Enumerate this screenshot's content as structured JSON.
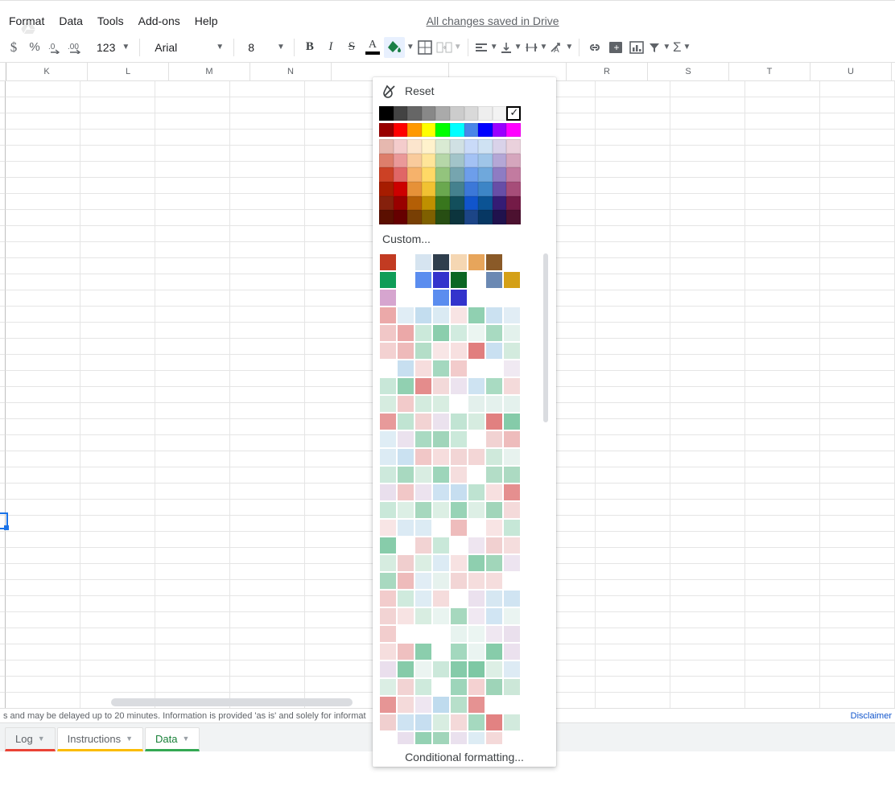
{
  "menus": [
    "Format",
    "Data",
    "Tools",
    "Add-ons",
    "Help"
  ],
  "save_status": "All changes saved in Drive",
  "toolbar": {
    "percent": "%",
    "decrement": ".0",
    "increment": ".00",
    "more_formats": "123",
    "font": "Arial",
    "fontsize": "8",
    "bold": "B",
    "italic": "I",
    "strike": "S",
    "textcolor": "A"
  },
  "columns": [
    "K",
    "L",
    "M",
    "N",
    "",
    "",
    "R",
    "S",
    "T",
    "U"
  ],
  "popover": {
    "reset_label": "Reset",
    "grayscale": [
      "#000000",
      "#434343",
      "#666666",
      "#888888",
      "#aaaaaa",
      "#cccccc",
      "#d9d9d9",
      "#eeeeee",
      "#f3f3f3",
      "#ffffff"
    ],
    "standard": [
      "#980000",
      "#ff0000",
      "#ff9900",
      "#ffff00",
      "#00ff00",
      "#00ffff",
      "#4a86e8",
      "#0000ff",
      "#9900ff",
      "#ff00ff"
    ],
    "theme": [
      [
        "#e6b8af",
        "#f4cccc",
        "#fce5cd",
        "#fff2cc",
        "#d9ead3",
        "#d0e0e3",
        "#c9daf8",
        "#cfe2f3",
        "#d9d2e9",
        "#ead1dc"
      ],
      [
        "#dd7e6b",
        "#ea9999",
        "#f9cb9c",
        "#ffe599",
        "#b6d7a8",
        "#a2c4c9",
        "#a4c2f4",
        "#9fc5e8",
        "#b4a7d6",
        "#d5a6bd"
      ],
      [
        "#cc4125",
        "#e06666",
        "#f6b26b",
        "#ffd966",
        "#93c47d",
        "#76a5af",
        "#6d9eeb",
        "#6fa8dc",
        "#8e7cc3",
        "#c27ba0"
      ],
      [
        "#a61c00",
        "#cc0000",
        "#e69138",
        "#f1c232",
        "#6aa84f",
        "#45818e",
        "#3c78d8",
        "#3d85c6",
        "#674ea7",
        "#a64d79"
      ],
      [
        "#85200c",
        "#990000",
        "#b45f06",
        "#bf9000",
        "#38761d",
        "#134f5c",
        "#1155cc",
        "#0b5394",
        "#351c75",
        "#741b47"
      ],
      [
        "#5b0f00",
        "#660000",
        "#783f04",
        "#7f6000",
        "#274e13",
        "#0c343d",
        "#1c4587",
        "#073763",
        "#20124d",
        "#4c1130"
      ]
    ],
    "custom_label": "Custom...",
    "custom_rows": [
      [
        "#c23b22",
        "#ffffff",
        "#d6e4f0",
        "#2f3e4d",
        "#f5d7b3",
        "#e7a55b",
        "#8a5a28",
        "#ffffff",
        "#8a5a28",
        "#ffffff"
      ],
      [
        "#0f9d58",
        "#ffffff",
        "#5b8def",
        "#3333cc",
        "#0b6623",
        "#ffffff",
        "#6b89b3",
        "#d4a017",
        "#ffffff",
        "#aac4e6"
      ],
      [
        "#d6a5cf",
        "#ffffff",
        "#ffffff",
        "#5b8def",
        "#3333cc",
        "#ffffff",
        "#ffffff",
        "#ffffff",
        "#ffffff",
        "#ffffff"
      ]
    ],
    "seed_colors": [
      "#e48c8c",
      "#f0c3c3",
      "#f6dede",
      "#d2eadd",
      "#a9d9c0",
      "#8ecfaf",
      "#d9e9f3",
      "#c7dff0",
      "#ece3ef",
      "#e6f2ee",
      "#f2d4d4",
      "#c5e6d6"
    ],
    "cond_label": "Conditional formatting..."
  },
  "quotes": {
    "left": "s and may be delayed up to 20 minutes. Information is provided 'as is' and solely for informat",
    "disclaimer": "Disclaimer"
  },
  "tabs": [
    {
      "label": "Log",
      "cls": "red"
    },
    {
      "label": "Instructions",
      "cls": "ylw"
    },
    {
      "label": "Data",
      "cls": "grn"
    }
  ]
}
